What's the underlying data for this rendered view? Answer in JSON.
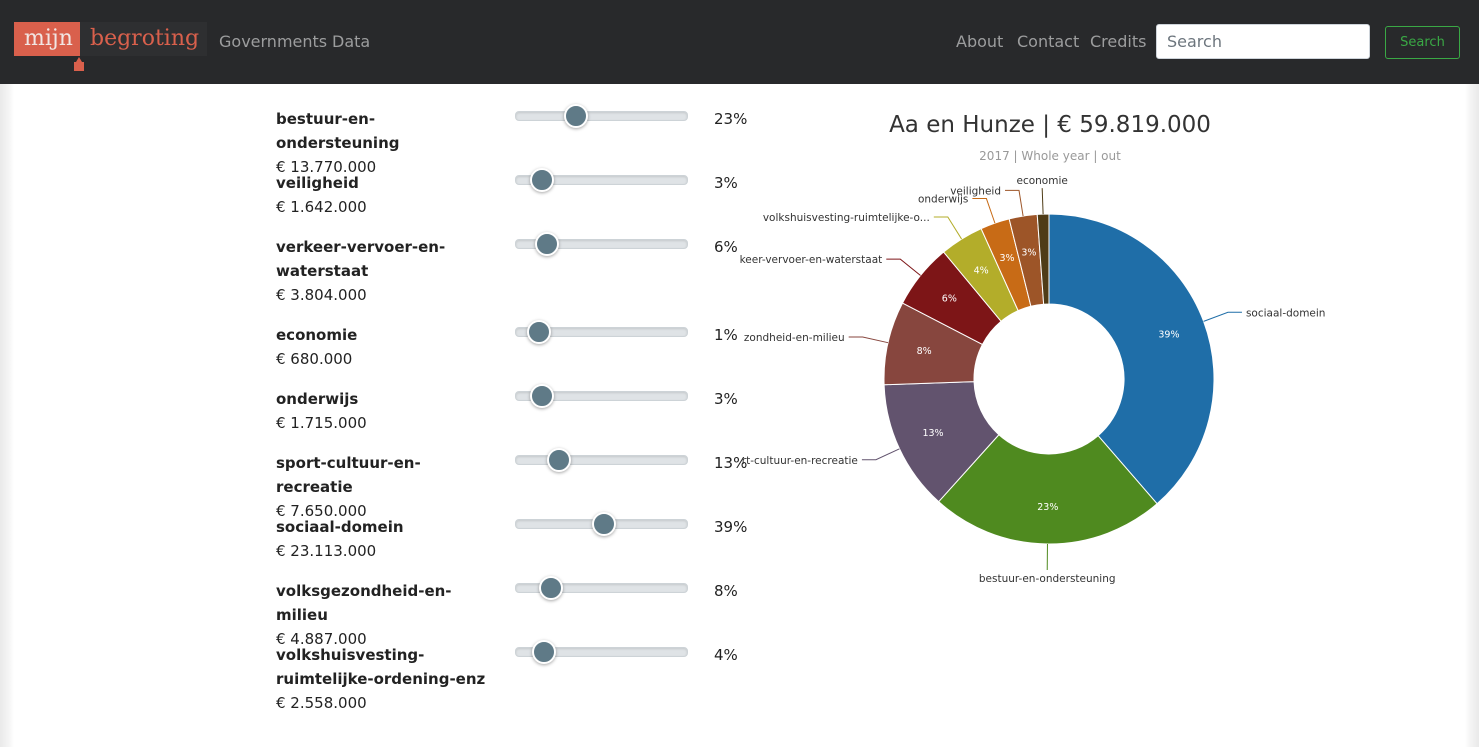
{
  "navbar": {
    "logo_left": "mijn",
    "logo_right": "begroting",
    "links_left": [
      "Governments",
      "Data"
    ],
    "links_right": [
      "About",
      "Contact",
      "Credits"
    ],
    "search_placeholder": "Search",
    "search_button": "Search"
  },
  "budget": [
    {
      "name": "bestuur-en-ondersteuning",
      "amount": "€ 13.770.000",
      "percent_label": "23%",
      "slider_value": 0.23
    },
    {
      "name": "veiligheid",
      "amount": "€ 1.642.000",
      "percent_label": "3%",
      "slider_value": 0.03
    },
    {
      "name": "verkeer-vervoer-en-waterstaat",
      "amount": "€ 3.804.000",
      "percent_label": "6%",
      "slider_value": 0.06
    },
    {
      "name": "economie",
      "amount": "€ 680.000",
      "percent_label": "1%",
      "slider_value": 0.01
    },
    {
      "name": "onderwijs",
      "amount": "€ 1.715.000",
      "percent_label": "3%",
      "slider_value": 0.03
    },
    {
      "name": "sport-cultuur-en-recreatie",
      "amount": "€ 7.650.000",
      "percent_label": "13%",
      "slider_value": 0.13
    },
    {
      "name": "sociaal-domein",
      "amount": "€ 23.113.000",
      "percent_label": "39%",
      "slider_value": 0.39
    },
    {
      "name": "volksgezondheid-en-milieu",
      "amount": "€ 4.887.000",
      "percent_label": "8%",
      "slider_value": 0.08
    },
    {
      "name": "volkshuisvesting-ruimtelijke-ordening-enz",
      "amount": "€ 2.558.000",
      "percent_label": "4%",
      "slider_value": 0.04
    }
  ],
  "chart_data": {
    "type": "pie",
    "title": "Aa en Hunze | € 59.819.000",
    "subtitle": "2017 | Whole year | out",
    "slices": [
      {
        "name": "sociaal-domein",
        "label": "sociaal-domein",
        "value": 23113000,
        "percent_label": "39%",
        "color": "#1f6ea8"
      },
      {
        "name": "bestuur-en-ondersteuning",
        "label": "bestuur-en-ondersteuning",
        "value": 13770000,
        "percent_label": "23%",
        "color": "#4f8a1f"
      },
      {
        "name": "sport-cultuur-en-recreatie",
        "label": "rt-cultuur-en-recreatie",
        "value": 7650000,
        "percent_label": "13%",
        "color": "#62536e"
      },
      {
        "name": "volksgezondheid-en-milieu",
        "label": "zondheid-en-milieu",
        "value": 4887000,
        "percent_label": "8%",
        "color": "#87463e"
      },
      {
        "name": "verkeer-vervoer-en-waterstaat",
        "label": "keer-vervoer-en-waterstaat",
        "value": 3804000,
        "percent_label": "6%",
        "color": "#7d1517"
      },
      {
        "name": "volkshuisvesting-ruimtelijke-ordening-enz",
        "label": "volkshuisvesting-ruimtelijke-o...",
        "value": 2558000,
        "percent_label": "4%",
        "color": "#b3ad2a"
      },
      {
        "name": "onderwijs",
        "label": "onderwijs",
        "value": 1715000,
        "percent_label": "3%",
        "color": "#c86b16"
      },
      {
        "name": "veiligheid",
        "label": "veiligheid",
        "value": 1642000,
        "percent_label": "3%",
        "color": "#9d5528"
      },
      {
        "name": "economie",
        "label": "economie",
        "value": 680000,
        "percent_label": "",
        "color": "#4f3c17"
      }
    ]
  }
}
